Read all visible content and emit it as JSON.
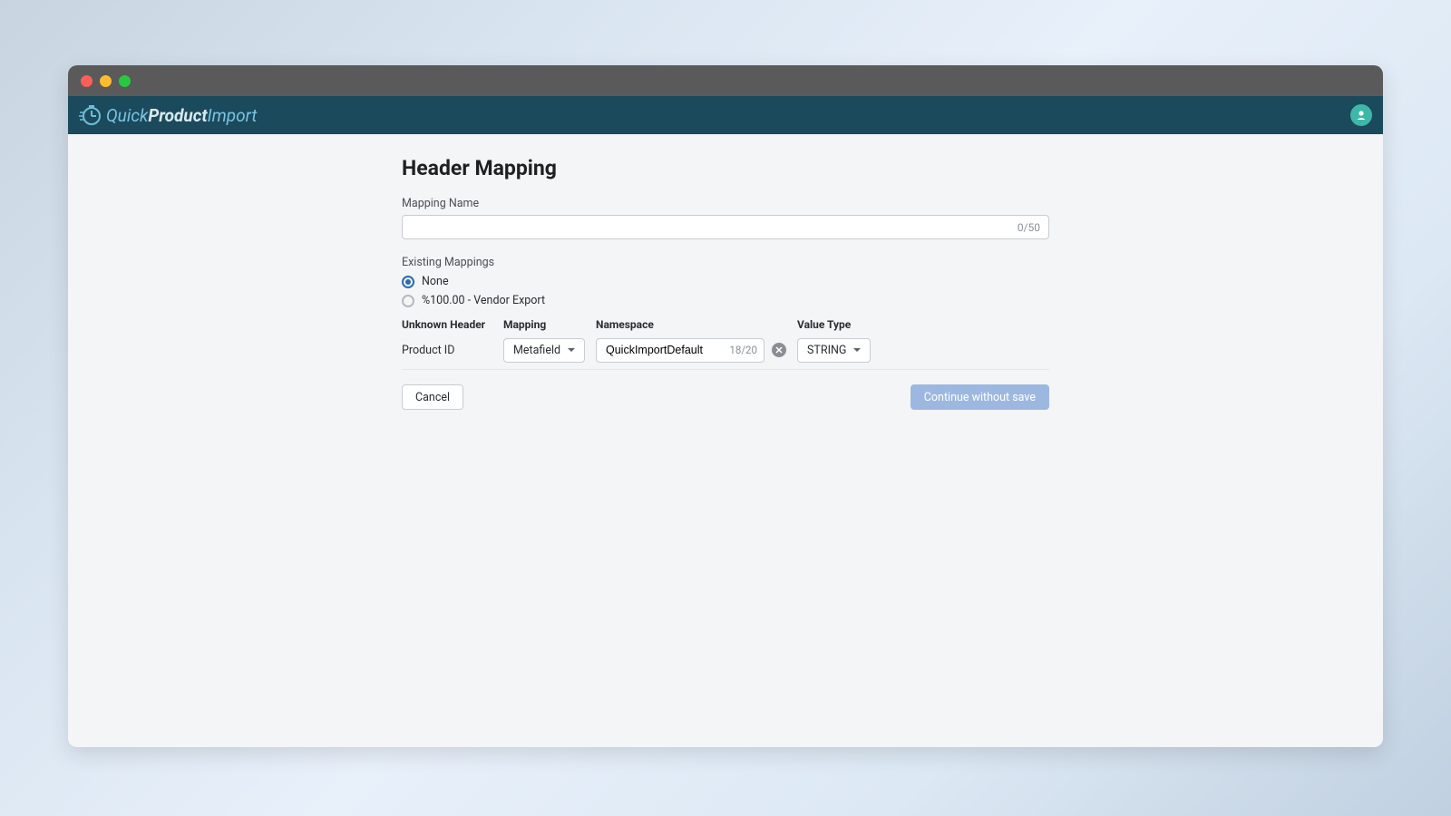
{
  "brand": {
    "quick": "Quick",
    "product": "Product",
    "import": "Import"
  },
  "page": {
    "title": "Header Mapping"
  },
  "mappingName": {
    "label": "Mapping Name",
    "value": "",
    "counter": "0/50"
  },
  "existing": {
    "label": "Existing Mappings",
    "options": [
      {
        "label": "None",
        "selected": true
      },
      {
        "label": "%100.00 - Vendor Export",
        "selected": false
      }
    ]
  },
  "columns": {
    "unknown": "Unknown Header",
    "mapping": "Mapping",
    "namespace": "Namespace",
    "valueType": "Value Type"
  },
  "row": {
    "unknown": "Product ID",
    "mapping": "Metafield",
    "namespace": "QuickImportDefault",
    "namespaceCounter": "18/20",
    "valueType": "STRING"
  },
  "footer": {
    "cancel": "Cancel",
    "continue": "Continue without save"
  }
}
